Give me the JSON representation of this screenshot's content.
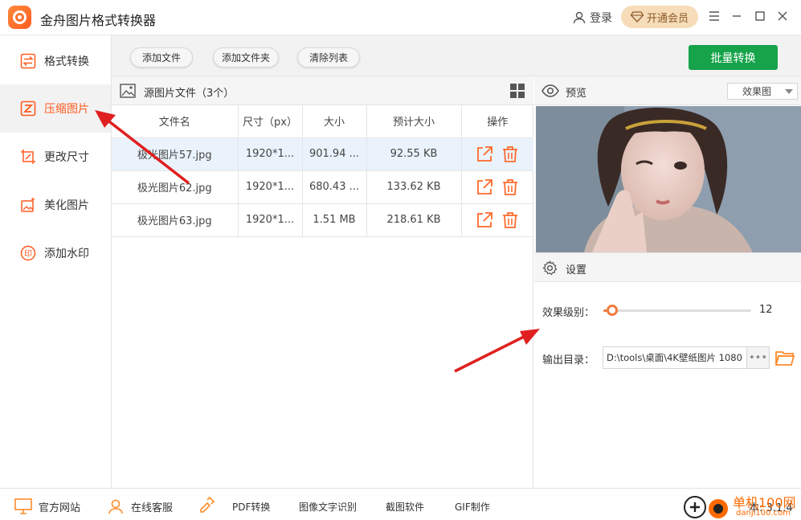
{
  "app": {
    "title": "金舟图片格式转换器",
    "login": "登录",
    "vip": "开通会员"
  },
  "sidebar": {
    "items": [
      {
        "label": "格式转换",
        "icon": "swap-icon"
      },
      {
        "label": "压缩图片",
        "icon": "compress-icon",
        "active": true
      },
      {
        "label": "更改尺寸",
        "icon": "crop-icon"
      },
      {
        "label": "美化图片",
        "icon": "beautify-icon"
      },
      {
        "label": "添加水印",
        "icon": "watermark-icon"
      }
    ]
  },
  "toolbar": {
    "add_file": "添加文件",
    "add_folder": "添加文件夹",
    "clear_list": "清除列表",
    "batch_convert": "批量转换"
  },
  "files": {
    "header": "源图片文件（3个）",
    "columns": [
      "文件名",
      "尺寸（px）",
      "大小",
      "预计大小",
      "操作"
    ],
    "rows": [
      {
        "name": "极光图片57.jpg",
        "dims": "1920*1...",
        "size": "901.94 ...",
        "est": "92.55 KB",
        "selected": true
      },
      {
        "name": "极光图片62.jpg",
        "dims": "1920*1...",
        "size": "680.43 ...",
        "est": "133.62 KB"
      },
      {
        "name": "极光图片63.jpg",
        "dims": "1920*1...",
        "size": "1.51 MB",
        "est": "218.61 KB"
      }
    ]
  },
  "preview": {
    "title": "预览",
    "mode": "效果图"
  },
  "settings": {
    "title": "设置",
    "level_label": "效果级别：",
    "level_value": "12",
    "level_fraction": 0.06,
    "output_label": "输出目录：",
    "output_path": "D:\\tools\\桌面\\4K壁纸图片 1080",
    "more": "•••"
  },
  "footer": {
    "website": "官方网站",
    "support": "在线客服",
    "pdf": "PDF转换",
    "ocr": "图像文字识别",
    "screenshot": "截图软件",
    "gif": "GIF制作",
    "version": "本: 3.1.4"
  },
  "watermark": {
    "site": "单机100网",
    "url": "danji100.com"
  },
  "colors": {
    "accent": "#ff5a1f",
    "green": "#16a34a",
    "arrow": "#e02020"
  }
}
